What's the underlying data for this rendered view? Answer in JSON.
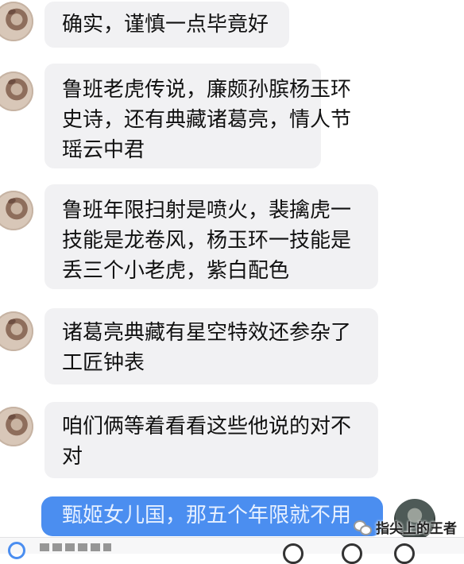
{
  "messages": [
    {
      "lines": [
        "确实，谨慎一点毕竟好"
      ]
    },
    {
      "lines": [
        "鲁班老虎传说，廉颇孙膑杨玉环",
        "史诗，还有典藏诸葛亮，情人节",
        "瑶云中君"
      ]
    },
    {
      "lines": [
        "鲁班年限扫射是喷火，裴擒虎一",
        "技能是龙卷风，杨玉环一技能是",
        "丢三个小老虎，紫白配色"
      ]
    },
    {
      "lines": [
        "诸葛亮典藏有星空特效还参杂了",
        "工匠钟表"
      ]
    },
    {
      "lines": [
        "咱们俩等着看看这些他说的对不",
        "对"
      ]
    }
  ],
  "self_message": "甄姬女儿国，那五个年限就不用",
  "watermark": "指尖上的王者",
  "colors": {
    "bubble": "#f1f1f3",
    "self_bubble": "#4b8ef0"
  }
}
